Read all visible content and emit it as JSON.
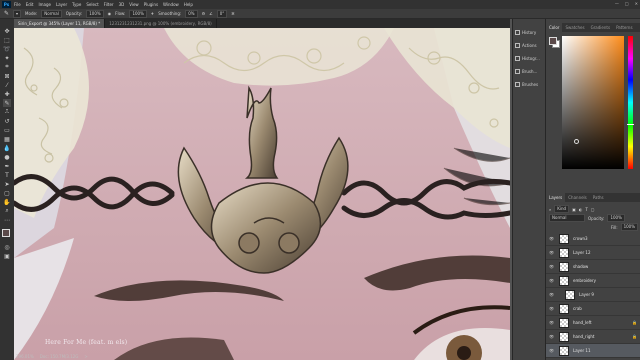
{
  "app": {
    "logo": "Ps"
  },
  "menu": [
    "File",
    "Edit",
    "Image",
    "Layer",
    "Type",
    "Select",
    "Filter",
    "3D",
    "View",
    "Plugins",
    "Window",
    "Help"
  ],
  "window_controls": [
    "—",
    "□",
    "✕"
  ],
  "options_bar": {
    "mode_label": "Mode:",
    "mode": "Normal",
    "opacity_label": "Opacity:",
    "opacity": "100%",
    "flow_label": "Flow:",
    "flow": "100%",
    "smoothing_label": "Smoothing:",
    "smoothing": "0%",
    "angle": "0°"
  },
  "tabs": [
    "Sirin_Export @ 345% (Layer 11, RGB/8) *",
    "1231231231231.png @ 100% (embroidery, RGB/8)"
  ],
  "status": {
    "zoom": "296.01%",
    "doc": "Doc: 150.7M/3.12G",
    "arrow": ">"
  },
  "watermark": "Here For Me (feat. m els)",
  "mid_panel": [
    "History",
    "Actions",
    "Histogr...",
    "Brush...",
    "Brushes"
  ],
  "color_tabs": [
    "Color",
    "Swatches",
    "Gradients",
    "Patterns"
  ],
  "colors": {
    "foreground": "#5b4a4a",
    "background": "#ffffff",
    "picker_hue": "#ff8c1a"
  },
  "layer_tabs": [
    "Layers",
    "Channels",
    "Paths"
  ],
  "layers_controls": {
    "kind": "Kind",
    "blend": "Normal",
    "opacity_label": "Opacity:",
    "opacity": "100%",
    "fill_label": "Fill:",
    "fill": "100%"
  },
  "layers": [
    {
      "name": "crown3",
      "selected": false,
      "locked": false
    },
    {
      "name": "Layer 12",
      "selected": false,
      "locked": false
    },
    {
      "name": "shadow",
      "selected": false,
      "locked": false
    },
    {
      "name": "embroidery",
      "selected": false,
      "locked": false
    },
    {
      "name": "Layer 9",
      "selected": false,
      "locked": false
    },
    {
      "name": "crab",
      "selected": false,
      "locked": false
    },
    {
      "name": "hand_left",
      "selected": false,
      "locked": true
    },
    {
      "name": "hand_right",
      "selected": false,
      "locked": true
    },
    {
      "name": "Layer 11",
      "selected": true,
      "locked": false
    }
  ]
}
